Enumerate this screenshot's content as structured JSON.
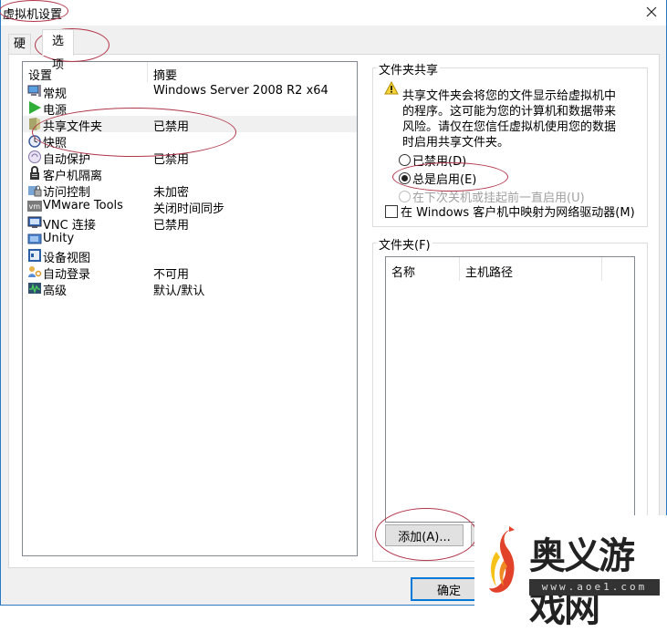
{
  "window": {
    "title": "虚拟机设置",
    "close_icon": "close-icon"
  },
  "tabs": [
    {
      "label": "硬件",
      "active": false
    },
    {
      "label": "选项",
      "active": true
    }
  ],
  "settings_list": {
    "columns": [
      "设置",
      "摘要"
    ],
    "rows": [
      {
        "name": "常规",
        "summary": "Windows Server 2008 R2 x64",
        "icon": "computer-icon"
      },
      {
        "name": "电源",
        "summary": "",
        "icon": "play-icon"
      },
      {
        "name": "共享文件夹",
        "summary": "已禁用",
        "icon": "shared-folder-icon",
        "selected": true
      },
      {
        "name": "快照",
        "summary": "",
        "icon": "snapshot-clock-icon"
      },
      {
        "name": "自动保护",
        "summary": "已禁用",
        "icon": "autoprotect-icon"
      },
      {
        "name": "客户机隔离",
        "summary": "",
        "icon": "lock-icon"
      },
      {
        "name": "访问控制",
        "summary": "未加密",
        "icon": "access-control-icon"
      },
      {
        "name": "VMware Tools",
        "summary": "关闭时间同步",
        "icon": "vmware-tools-icon"
      },
      {
        "name": "VNC 连接",
        "summary": "已禁用",
        "icon": "vnc-monitor-icon"
      },
      {
        "name": "Unity",
        "summary": "",
        "icon": "unity-window-icon"
      },
      {
        "name": "设备视图",
        "summary": "",
        "icon": "device-view-icon"
      },
      {
        "name": "自动登录",
        "summary": "不可用",
        "icon": "user-key-icon"
      },
      {
        "name": "高级",
        "summary": "默认/默认",
        "icon": "advanced-chart-icon"
      }
    ]
  },
  "folder_sharing": {
    "group_label": "文件夹共享",
    "warning_icon": "warning-icon",
    "warning_lines": [
      "共享文件夹会将您的文件显示给虚拟机中",
      "的程序。这可能为您的计算机和数据带来",
      "风险。请仅在您信任虚拟机使用您的数据",
      "时启用共享文件夹。"
    ],
    "options": [
      {
        "label": "已禁用(D)",
        "checked": false,
        "disabled": false
      },
      {
        "label": "总是启用(E)",
        "checked": true,
        "disabled": false
      },
      {
        "label": "在下次关机或挂起前一直启用(U)",
        "checked": false,
        "disabled": true
      }
    ],
    "map_drive_label": "在 Windows 客户机中映射为网络驱动器(M)",
    "map_drive_checked": false
  },
  "folders": {
    "group_label": "文件夹(F)",
    "columns": [
      "名称",
      "主机路径"
    ],
    "add_button": "添加(A)..."
  },
  "footer": {
    "ok_button": "确定"
  },
  "watermark": {
    "name": "奥义游戏网",
    "url": "www.aoe1.com",
    "colors": {
      "flame_orange": "#f08a24",
      "flame_red": "#e2412a",
      "flame_yellow": "#f6c21a"
    }
  },
  "annotation_color": "#b2364a"
}
